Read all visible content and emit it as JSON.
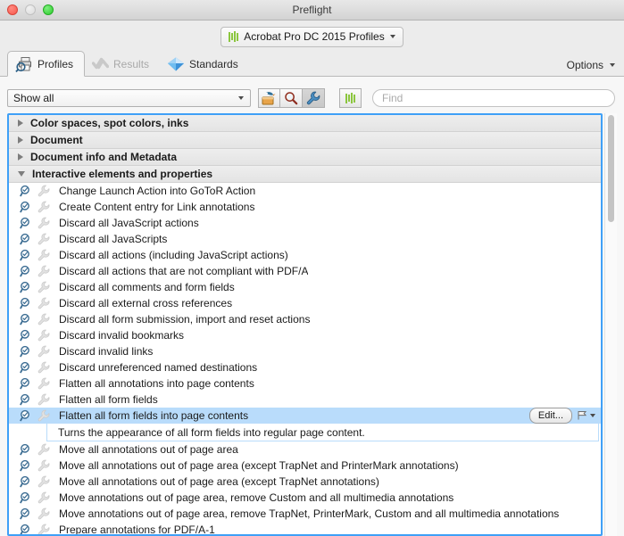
{
  "window": {
    "title": "Preflight",
    "traffic_lights": [
      "close-button",
      "minimize-button",
      "zoom-button"
    ]
  },
  "profile_selector": {
    "label": "Acrobat Pro DC 2015 Profiles",
    "icon": "green-bars-icon",
    "caret": "chevron-down-icon"
  },
  "tabs": [
    {
      "label": "Profiles",
      "icon": "printer-magnifier-icon",
      "state": "active"
    },
    {
      "label": "Results",
      "icon": "crossed-checks-icon",
      "state": "disabled"
    },
    {
      "label": "Standards",
      "icon": "blue-diamond-icon",
      "state": "normal"
    }
  ],
  "options_menu": {
    "label": "Options",
    "caret": "chevron-down-icon"
  },
  "toolbar": {
    "filter_value": "Show all",
    "buttons": [
      {
        "name": "bird-lock-button",
        "pressed": false
      },
      {
        "name": "magnifier-button",
        "pressed": false
      },
      {
        "name": "wrench-button",
        "pressed": true
      }
    ],
    "profiles_button": {
      "name": "green-bars-button"
    },
    "find_placeholder": "Find",
    "find_value": ""
  },
  "colors": {
    "selection_blue": "#b9dcfb",
    "focus_ring": "#3fa0f7",
    "accent_green": "#8cc63f",
    "group_header": "#e8e8e8"
  },
  "list": {
    "groups": [
      {
        "label": "Color spaces, spot colors, inks",
        "expanded": false,
        "items": []
      },
      {
        "label": "Document",
        "expanded": false,
        "items": []
      },
      {
        "label": "Document info and Metadata",
        "expanded": false,
        "items": []
      },
      {
        "label": "Interactive elements and properties",
        "expanded": true,
        "items": [
          {
            "label": "Change Launch Action into GoToR Action",
            "selected": false
          },
          {
            "label": "Create Content entry for Link annotations",
            "selected": false
          },
          {
            "label": "Discard all JavaScript actions",
            "selected": false
          },
          {
            "label": "Discard all JavaScripts",
            "selected": false
          },
          {
            "label": "Discard all actions (including JavaScript actions)",
            "selected": false
          },
          {
            "label": "Discard all actions that are not compliant with PDF/A",
            "selected": false
          },
          {
            "label": "Discard all comments and form fields",
            "selected": false
          },
          {
            "label": "Discard all external cross references",
            "selected": false
          },
          {
            "label": "Discard all form submission, import and reset actions",
            "selected": false
          },
          {
            "label": "Discard invalid bookmarks",
            "selected": false
          },
          {
            "label": "Discard invalid links",
            "selected": false
          },
          {
            "label": "Discard unreferenced named destinations",
            "selected": false
          },
          {
            "label": "Flatten all annotations into page contents",
            "selected": false
          },
          {
            "label": "Flatten all form fields",
            "selected": false
          },
          {
            "label": "Flatten all form fields into page contents",
            "selected": true,
            "edit_label": "Edit...",
            "description": "Turns the appearance of all form  fields into regular page content."
          },
          {
            "label": "Move all annotations out of page area",
            "selected": false
          },
          {
            "label": "Move all annotations out of page area (except TrapNet and PrinterMark annotations)",
            "selected": false
          },
          {
            "label": "Move all annotations out of page area (except TrapNet annotations)",
            "selected": false
          },
          {
            "label": "Move annotations out of page area, remove Custom and all multimedia annotations",
            "selected": false
          },
          {
            "label": "Move annotations out of page area, remove TrapNet, PrinterMark, Custom and all multimedia annotations",
            "selected": false
          },
          {
            "label": "Prepare annotations for PDF/A-1",
            "selected": false
          }
        ]
      }
    ]
  }
}
